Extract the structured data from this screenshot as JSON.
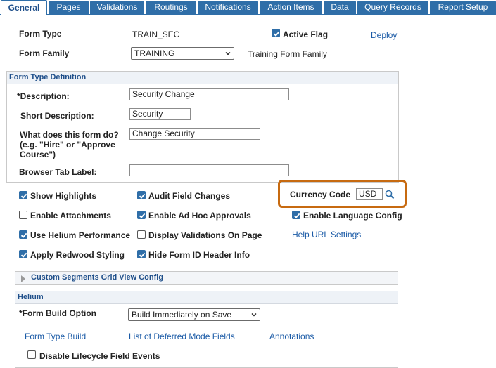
{
  "tabs": [
    "General",
    "Pages",
    "Validations",
    "Routings",
    "Notifications",
    "Action Items",
    "Data",
    "Query Records",
    "Report Setup"
  ],
  "form_type": {
    "label": "Form Type",
    "value": "TRAIN_SEC"
  },
  "active_flag": {
    "label": "Active Flag",
    "checked": true
  },
  "deploy_link": "Deploy",
  "form_family": {
    "label": "Form Family",
    "selected": "TRAINING",
    "description": "Training Form Family"
  },
  "definition": {
    "title": "Form Type Definition",
    "description": {
      "label": "*Description:",
      "value": "Security Change"
    },
    "short_description": {
      "label": "Short Description:",
      "value": "Security"
    },
    "what_does": {
      "label_line1": "What does this form do?",
      "label_line2": "(e.g. \"Hire\" or \"Approve",
      "label_line3": "Course\")",
      "value": "Change Security"
    },
    "browser_tab": {
      "label": "Browser Tab Label:",
      "value": ""
    }
  },
  "options": {
    "show_highlights": {
      "label": "Show Highlights",
      "checked": true
    },
    "audit_field_changes": {
      "label": "Audit Field Changes",
      "checked": true
    },
    "currency_code": {
      "label": "Currency Code",
      "value": "USD"
    },
    "enable_attachments": {
      "label": "Enable Attachments",
      "checked": false
    },
    "enable_ad_hoc": {
      "label": "Enable Ad Hoc Approvals",
      "checked": true
    },
    "enable_language": {
      "label": "Enable Language Config",
      "checked": true
    },
    "use_helium": {
      "label": "Use Helium Performance",
      "checked": true
    },
    "display_validations": {
      "label": "Display Validations On Page",
      "checked": false
    },
    "help_url": "Help URL Settings",
    "apply_redwood": {
      "label": "Apply Redwood Styling",
      "checked": true
    },
    "hide_form_id": {
      "label": "Hide Form ID Header Info",
      "checked": true
    }
  },
  "custom_segments": {
    "title": "Custom Segments Grid View Config"
  },
  "helium": {
    "title": "Helium",
    "form_build_option": {
      "label": "*Form Build Option",
      "selected": "Build Immediately on Save"
    },
    "links": [
      "Form Type Build",
      "List of Deferred Mode Fields",
      "Annotations"
    ],
    "disable_lifecycle": {
      "label": "Disable Lifecycle Field Events",
      "checked": false
    }
  },
  "colors": {
    "tab_blue": "#2f6ea8",
    "link_blue": "#1a5aa6",
    "highlight_orange": "#c76a10"
  }
}
